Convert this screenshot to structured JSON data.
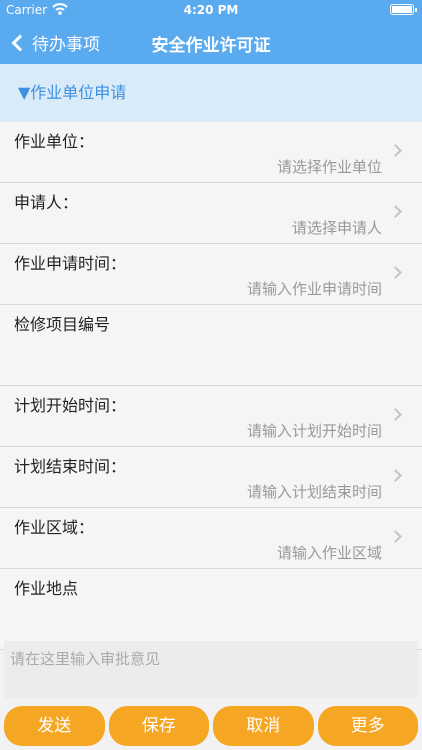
{
  "status_bar": {
    "carrier": "Carrier",
    "time": "4:20 PM"
  },
  "nav": {
    "back_label": "待办事项",
    "title": "安全作业许可证"
  },
  "section": {
    "title": "▼作业单位申请"
  },
  "rows": [
    {
      "label": "作业单位：",
      "placeholder": "请选择作业单位"
    },
    {
      "label": "申请人：",
      "placeholder": "请选择申请人"
    },
    {
      "label": "作业申请时间：",
      "placeholder": "请输入作业申请时间"
    },
    {
      "label": "检修项目编号"
    },
    {
      "label": "计划开始时间：",
      "placeholder": "请输入计划开始时间"
    },
    {
      "label": "计划结束时间：",
      "placeholder": "请输入计划结束时间"
    },
    {
      "label": "作业区域：",
      "placeholder": "请输入作业区域"
    },
    {
      "label": "作业地点"
    }
  ],
  "comment": {
    "placeholder": "请在这里输入审批意见"
  },
  "buttons": {
    "send": "发送",
    "save": "保存",
    "cancel": "取消",
    "more": "更多"
  },
  "colors": {
    "nav": "#5aaaf0",
    "section_bg": "#d9ebf9",
    "section_text": "#3d8fe0",
    "button": "#f5a623"
  }
}
